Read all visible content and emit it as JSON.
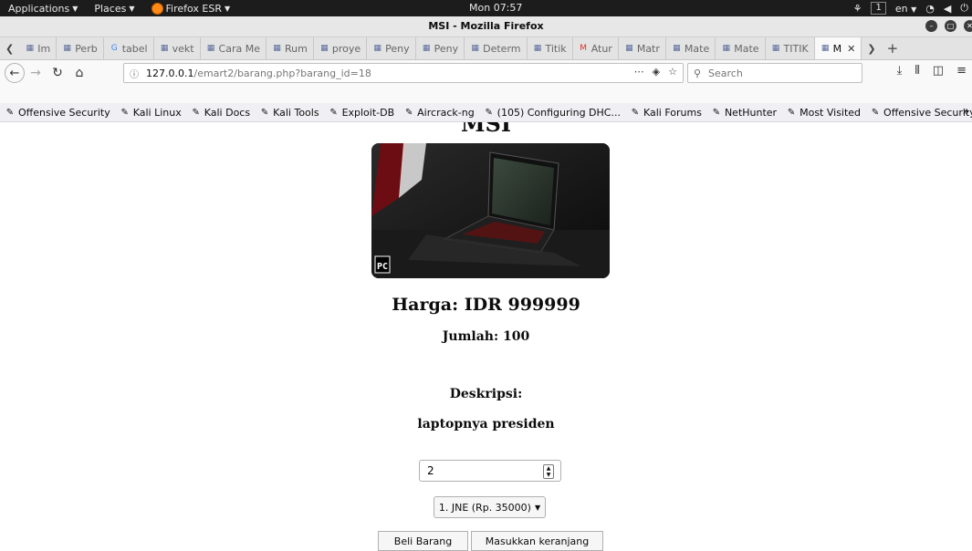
{
  "gnome": {
    "applications": "Applications",
    "places": "Places",
    "app": "Firefox ESR",
    "clock": "Mon 07:57",
    "workspace": "1",
    "lang": "en"
  },
  "window": {
    "title": "MSI - Mozilla Firefox"
  },
  "tabs": [
    {
      "label": "Im",
      "icon": "page-icon"
    },
    {
      "label": "Perb",
      "icon": "page-icon"
    },
    {
      "label": "tabel",
      "icon": "google-icon"
    },
    {
      "label": "vekt",
      "icon": "page-icon"
    },
    {
      "label": "Cara Me",
      "icon": "page-icon"
    },
    {
      "label": "Rum",
      "icon": "page-icon"
    },
    {
      "label": "proye",
      "icon": "page-icon"
    },
    {
      "label": "Peny",
      "icon": "page-icon"
    },
    {
      "label": "Peny",
      "icon": "page-icon"
    },
    {
      "label": "Determ",
      "icon": "page-icon"
    },
    {
      "label": "Titik",
      "icon": "page-icon"
    },
    {
      "label": "Atur",
      "icon": "gmail-icon"
    },
    {
      "label": "Matr",
      "icon": "page-icon"
    },
    {
      "label": "Mate",
      "icon": "page-icon"
    },
    {
      "label": "Mate",
      "icon": "page-icon"
    },
    {
      "label": "TITIK",
      "icon": "page-icon"
    },
    {
      "label": "M",
      "icon": "page-icon",
      "active": true
    }
  ],
  "nav": {
    "url_host": "127.0.0.1",
    "url_path": "/emart2/barang.php?barang_id=18",
    "search_placeholder": "Search"
  },
  "bookmarks": [
    "Offensive Security",
    "Kali Linux",
    "Kali Docs",
    "Kali Tools",
    "Exploit-DB",
    "Aircrack-ng",
    "(105) Configuring DHC...",
    "Kali Forums",
    "NetHunter",
    "Most Visited",
    "Offensive Security"
  ],
  "product": {
    "heading": "MSI",
    "image_badge": "PC",
    "price": "Harga: IDR 999999",
    "quantity": "Jumlah: 100",
    "desc_label": "Deskripsi:",
    "description": "laptopnya presiden",
    "qty_value": "2",
    "shipping_selected": "1. JNE (Rp. 35000)",
    "buy_label": "Beli Barang",
    "cart_label": "Masukkan keranjang"
  }
}
